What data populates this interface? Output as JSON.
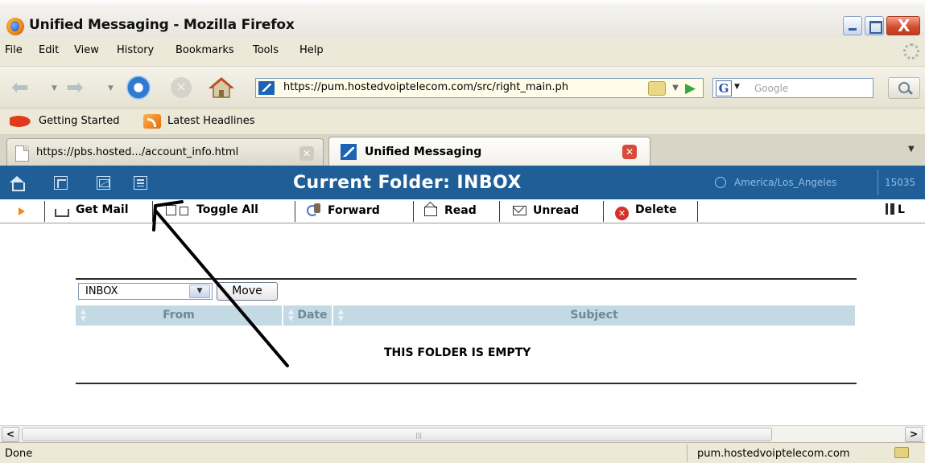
{
  "window": {
    "title": "Unified Messaging - Mozilla Firefox",
    "close_glyph": "X"
  },
  "menu": [
    "File",
    "Edit",
    "View",
    "History",
    "Bookmarks",
    "Tools",
    "Help"
  ],
  "nav": {
    "url": "https://pum.hostedvoiptelecom.com/src/right_main.ph",
    "search_placeholder": "Google",
    "search_engine": "G"
  },
  "bookmarks": [
    "Getting Started",
    "Latest Headlines"
  ],
  "tabs": [
    {
      "label": "https://pbs.hosted.../account_info.html",
      "active": false
    },
    {
      "label": "Unified Messaging",
      "active": true
    }
  ],
  "app": {
    "folder_title": "Current Folder: INBOX",
    "timezone": "America/Los_Angeles",
    "account": "15035"
  },
  "toolbar": {
    "get_mail": "Get Mail",
    "toggle_all": "Toggle All",
    "forward": "Forward",
    "read": "Read",
    "unread": "Unread",
    "delete": "Delete",
    "logout": "L"
  },
  "folder": {
    "selected": "INBOX",
    "move_label": "Move"
  },
  "table": {
    "columns": [
      "From",
      "Date",
      "Subject"
    ],
    "empty_message": "THIS FOLDER IS EMPTY"
  },
  "status": {
    "text": "Done",
    "host": "pum.hostedvoiptelecom.com"
  },
  "colors": {
    "app_header": "#1f5e97",
    "table_header": "#c3d9e4",
    "delete_icon": "#d6322a"
  }
}
